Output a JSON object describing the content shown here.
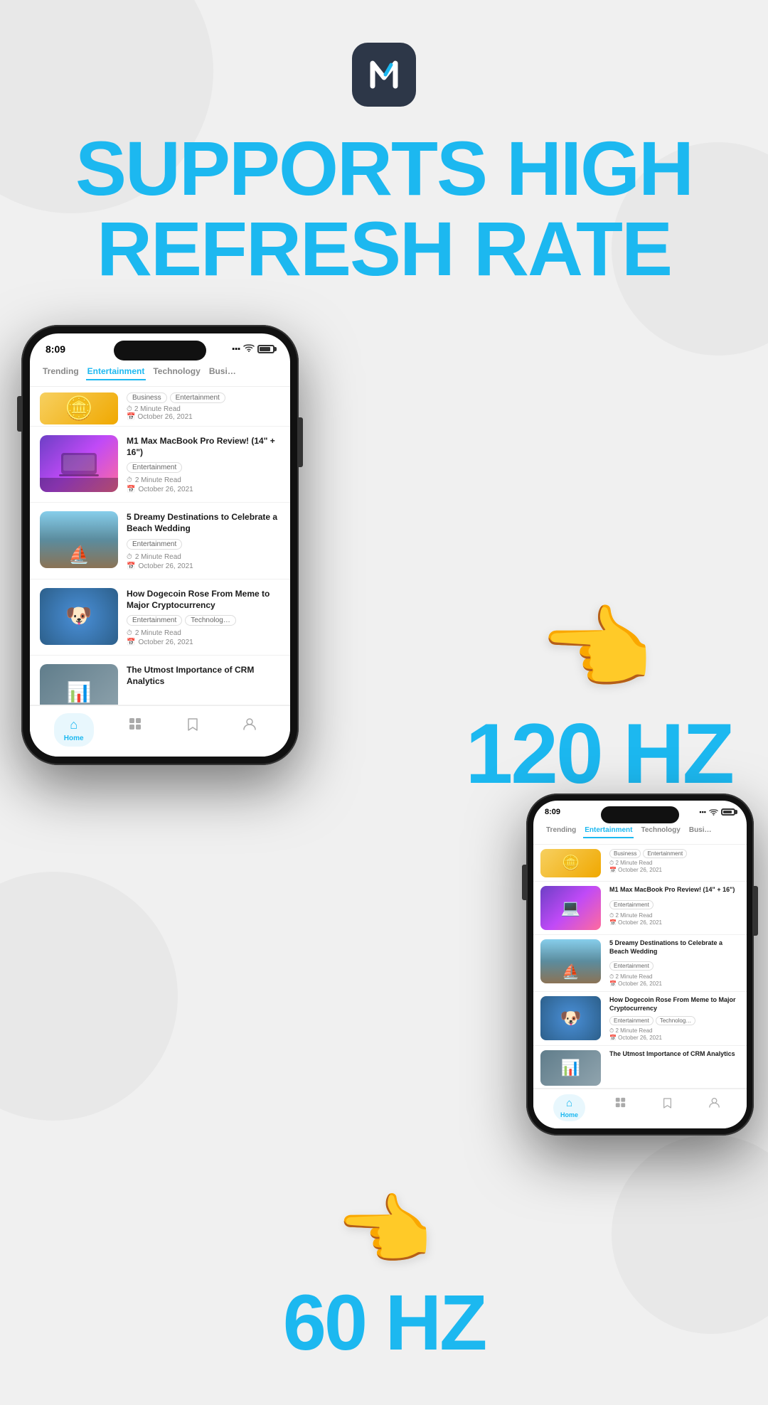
{
  "logo": {
    "icon": "↺",
    "alt": "App Logo"
  },
  "headline": {
    "line1": "SUPPORTS HIGH",
    "line2": "REFRESH RATE"
  },
  "hz_large": "120 HZ",
  "hz_small": "60 HZ",
  "phone_large": {
    "status": {
      "time": "8:09",
      "wifi": "▪▪▪",
      "battery": ""
    },
    "nav_tabs": [
      {
        "label": "Trending",
        "active": false
      },
      {
        "label": "Entertainment",
        "active": true
      },
      {
        "label": "Technology",
        "active": false
      },
      {
        "label": "Busi…",
        "active": false
      }
    ],
    "articles": [
      {
        "title": "",
        "tags": [
          "Business",
          "Entertainment"
        ],
        "read_time": "2 Minute Read",
        "date": "October 26, 2021",
        "thumb_type": "coins"
      },
      {
        "title": "M1 Max MacBook Pro Review! (14\" + 16\")",
        "tags": [
          "Entertainment"
        ],
        "read_time": "2 Minute Read",
        "date": "October 26, 2021",
        "thumb_type": "macbook"
      },
      {
        "title": "5 Dreamy Destinations to Celebrate a Beach Wedding",
        "tags": [
          "Entertainment"
        ],
        "read_time": "2 Minute Read",
        "date": "October 26, 2021",
        "thumb_type": "boats"
      },
      {
        "title": "How Dogecoin Rose From Meme to Major Cryptocurrency",
        "tags": [
          "Entertainment",
          "Technolog…"
        ],
        "read_time": "2 Minute Read",
        "date": "October 26, 2021",
        "thumb_type": "doge"
      },
      {
        "title": "The Utmost Importance of CRM Analytics",
        "tags": [],
        "read_time": "",
        "date": "",
        "thumb_type": "crm"
      }
    ],
    "bottom_nav": [
      {
        "icon": "⌂",
        "label": "Home",
        "active": true
      },
      {
        "icon": "⊞",
        "label": "",
        "active": false
      },
      {
        "icon": "⊡",
        "label": "",
        "active": false
      },
      {
        "icon": "◯",
        "label": "",
        "active": false
      }
    ]
  },
  "phone_small": {
    "status": {
      "time": "8:09",
      "wifi": "▪▪▪",
      "battery": ""
    },
    "nav_tabs": [
      {
        "label": "Trending",
        "active": false
      },
      {
        "label": "Entertainment",
        "active": true
      },
      {
        "label": "Technology",
        "active": false
      },
      {
        "label": "Busi…",
        "active": false
      }
    ],
    "articles": [
      {
        "title": "",
        "tags": [
          "Business",
          "Entertainment"
        ],
        "read_time": "2 Minute Read",
        "date": "October 26, 2021",
        "thumb_type": "coins"
      },
      {
        "title": "M1 Max MacBook Pro Review! (14\" + 16\")",
        "tags": [
          "Entertainment"
        ],
        "read_time": "2 Minute Read",
        "date": "October 26, 2021",
        "thumb_type": "macbook"
      },
      {
        "title": "5 Dreamy Destinations to Celebrate a Beach Wedding",
        "tags": [
          "Entertainment"
        ],
        "read_time": "2 Minute Read",
        "date": "October 26, 2021",
        "thumb_type": "boats"
      },
      {
        "title": "How Dogecoin Rose From Meme to Major Cryptocurrency",
        "tags": [
          "Entertainment",
          "Technolog…"
        ],
        "read_time": "2 Minute Read",
        "date": "October 26, 2021",
        "thumb_type": "doge"
      },
      {
        "title": "The Utmost Importance of CRM Analytics",
        "tags": [],
        "read_time": "",
        "date": "",
        "thumb_type": "crm"
      }
    ],
    "bottom_nav": [
      {
        "icon": "⌂",
        "label": "Home",
        "active": true
      },
      {
        "icon": "⊞",
        "label": "",
        "active": false
      },
      {
        "icon": "⊡",
        "label": "",
        "active": false
      },
      {
        "icon": "◯",
        "label": "",
        "active": false
      }
    ]
  }
}
